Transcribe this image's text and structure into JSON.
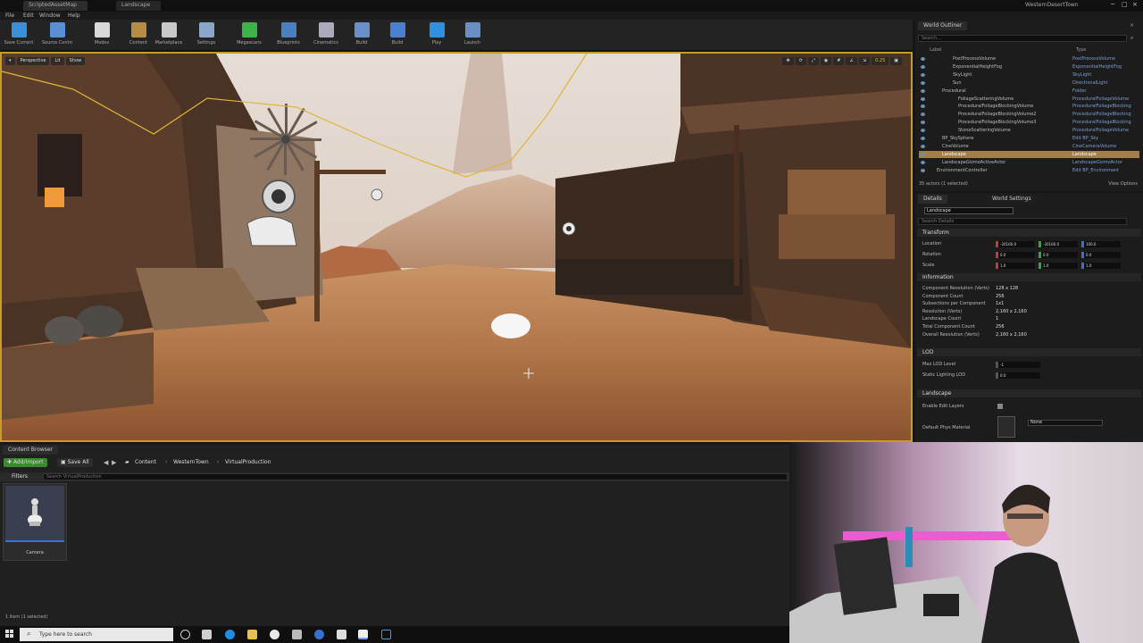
{
  "window": {
    "tabs": [
      "ScriptedAssetMap",
      "Landscape"
    ],
    "right_title": "WesternDesertTown"
  },
  "menu": [
    "File",
    "Edit",
    "Window",
    "Help"
  ],
  "toolbar": {
    "buttons": [
      {
        "label": "Save Current",
        "icon": "save-icon",
        "color": "#3a8fd6"
      },
      {
        "label": "Source Control",
        "icon": "source-control-icon",
        "color": "#5b8fd4"
      },
      {
        "label": "Modes",
        "icon": "modes-icon",
        "color": "#d9d9d9"
      },
      {
        "label": "Content",
        "icon": "content-icon",
        "color": "#b58d44"
      },
      {
        "label": "Marketplace",
        "icon": "marketplace-icon",
        "color": "#c9c9c9"
      },
      {
        "label": "Settings",
        "icon": "gear-icon",
        "color": "#8aa7c9"
      },
      {
        "label": "Megascans",
        "icon": "megascans-icon",
        "color": "#3bb54a"
      },
      {
        "label": "Blueprints",
        "icon": "blueprints-icon",
        "color": "#4a7fc0"
      },
      {
        "label": "Cinematics",
        "icon": "cinematics-icon",
        "color": "#aab"
      },
      {
        "label": "Build",
        "icon": "build-icon",
        "color": "#6b8fc8"
      },
      {
        "label": "Build",
        "icon": "build2-icon",
        "color": "#4d7fd0"
      },
      {
        "label": "Play",
        "icon": "play-icon",
        "color": "#2f8fe0"
      },
      {
        "label": "Launch",
        "icon": "launch-icon",
        "color": "#6a8fc4"
      }
    ]
  },
  "viewport": {
    "left_chips": [
      "Perspective",
      "Lit",
      "Show"
    ],
    "right_value": "0.25"
  },
  "outliner": {
    "tab": "World Outliner",
    "search_placeholder": "Search...",
    "col_label": "Label",
    "col_type": "Type",
    "rows": [
      {
        "name": "PostProcessVolume",
        "type": "PostProcessVolume",
        "indent": 4
      },
      {
        "name": "ExponentialHeightFog",
        "type": "ExponentialHeightFog",
        "indent": 4
      },
      {
        "name": "SkyLight",
        "type": "SkyLight",
        "indent": 4
      },
      {
        "name": "Sun",
        "type": "DirectionalLight",
        "indent": 4
      },
      {
        "name": "Procedural",
        "type": "Folder",
        "indent": 2
      },
      {
        "name": "FoliageScatteringVolume",
        "type": "ProceduralFoliageVolume",
        "indent": 5
      },
      {
        "name": "ProceduralFoliageBlockingVolume",
        "type": "ProceduralFoliageBlocking",
        "indent": 5
      },
      {
        "name": "ProceduralFoliageBlockingVolume2",
        "type": "ProceduralFoliageBlocking",
        "indent": 5
      },
      {
        "name": "ProceduralFoliageBlockingVolume3",
        "type": "ProceduralFoliageBlocking",
        "indent": 5
      },
      {
        "name": "StoneScatteringVolume",
        "type": "ProceduralFoliageVolume",
        "indent": 5
      },
      {
        "name": "BP_SkySphere",
        "type": "Edit BP_Sky",
        "indent": 2
      },
      {
        "name": "CineVolume",
        "type": "CineCameraVolume",
        "indent": 2
      },
      {
        "name": "Landscape",
        "type": "Landscape",
        "indent": 2,
        "selected": true
      },
      {
        "name": "LandscapeGizmoActiveActor",
        "type": "LandscapeGizmoActor",
        "indent": 2
      },
      {
        "name": "EnvironmentController",
        "type": "Edit BP_Environment",
        "indent": 1
      }
    ],
    "footer": "35 actors (1 selected)",
    "view_options": "View Options"
  },
  "details": {
    "tabs": [
      "Details",
      "World Settings"
    ],
    "actor_name": "Landscape",
    "search_placeholder": "Search Details",
    "sections": {
      "transform": "Transform",
      "information": "Information",
      "lod": "LOD",
      "landscape": "Landscape"
    },
    "transform_rows": [
      {
        "label": "Location",
        "x": "-20160.0",
        "y": "-20160.0",
        "z": "100.0"
      },
      {
        "label": "Rotation",
        "x": "0.0",
        "y": "0.0",
        "z": "0.0"
      },
      {
        "label": "Scale",
        "x": "1.0",
        "y": "1.0",
        "z": "1.0"
      }
    ],
    "info_rows": [
      {
        "label": "Component Resolution (Verts)",
        "value": "128 x 128"
      },
      {
        "label": "Component Count",
        "value": "256"
      },
      {
        "label": "Subsections per Component",
        "value": "1x1"
      },
      {
        "label": "Resolution (Verts)",
        "value": "2,160 x 2,160"
      },
      {
        "label": "Landscape Count",
        "value": "1"
      },
      {
        "label": "Total Component Count",
        "value": "256"
      },
      {
        "label": "Overall Resolution (Verts)",
        "value": "2,160 x 2,160"
      }
    ],
    "lod_rows": [
      {
        "label": "Max LOD Level",
        "value": "-1"
      },
      {
        "label": "Static Lighting LOD",
        "value": "0.0"
      }
    ],
    "landscape_rows": [
      {
        "label": "Enable Edit Layers",
        "value": ""
      },
      {
        "label": "Default Phys Material",
        "value": "None"
      }
    ]
  },
  "content_browser": {
    "title": "Content Browser",
    "add_import": "Add/Import",
    "save_all": "Save All",
    "breadcrumbs": [
      "Content",
      "WesternTown",
      "VirtualProduction"
    ],
    "filters": "Filters",
    "search_placeholder": "Search VirtualProduction",
    "asset_label": "Camera",
    "status": "1 item (1 selected)"
  },
  "taskbar": {
    "search_placeholder": "Type here to search"
  }
}
